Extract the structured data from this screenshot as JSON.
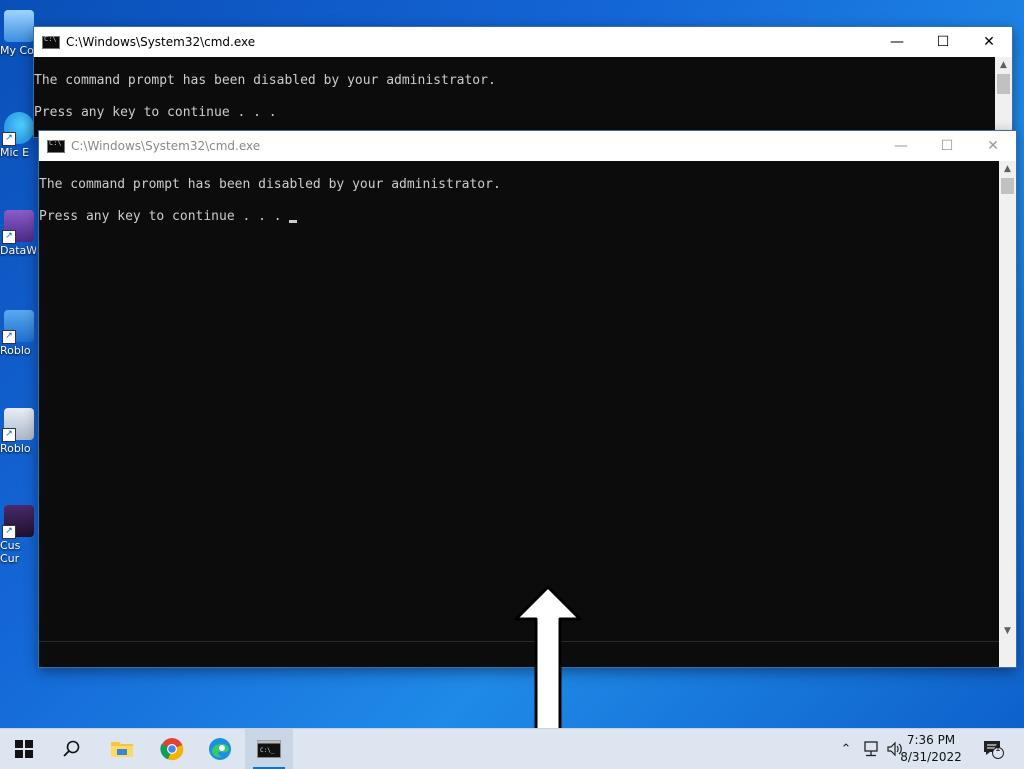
{
  "desktop": {
    "icons": [
      {
        "label": "My Co",
        "name": "desktop-icon-my-computer"
      },
      {
        "label": "Mic E",
        "name": "desktop-icon-microsoft-edge"
      },
      {
        "label": "DataW",
        "name": "desktop-icon-dataw"
      },
      {
        "label": "Roblo",
        "name": "desktop-icon-roblox-player"
      },
      {
        "label": "Roblo",
        "name": "desktop-icon-roblox-studio"
      },
      {
        "label": "Cus Cur",
        "name": "desktop-icon-custom-cursor"
      }
    ]
  },
  "back_window": {
    "title": "C:\\Windows\\System32\\cmd.exe",
    "lines": [
      "The command prompt has been disabled by your administrator.",
      "",
      "Press any key to continue . . ."
    ],
    "state": "active"
  },
  "front_window": {
    "title": "C:\\Windows\\System32\\cmd.exe",
    "lines": [
      "The command prompt has been disabled by your administrator.",
      "",
      "Press any key to continue . . . "
    ],
    "state": "inactive"
  },
  "window_buttons": {
    "minimize": "—",
    "maximize": "☐",
    "close": "✕"
  },
  "taskbar": {
    "items": [
      "start-icon",
      "search-icon",
      "file-explorer-icon",
      "chrome-icon",
      "edge-icon",
      "cmd-icon"
    ],
    "tray": {
      "chevron": "⌃",
      "network": "🖧",
      "volume": "🔊"
    },
    "clock_time": "7:36 PM",
    "clock_date": "8/31/2022",
    "notification_count": "1"
  },
  "cursor": "resize-vertical-cursor",
  "colors": {
    "console_bg": "#0c0c0c",
    "console_text": "#cccccc",
    "taskbar_bg": "#dde6f0",
    "accent": "#0078d4"
  }
}
